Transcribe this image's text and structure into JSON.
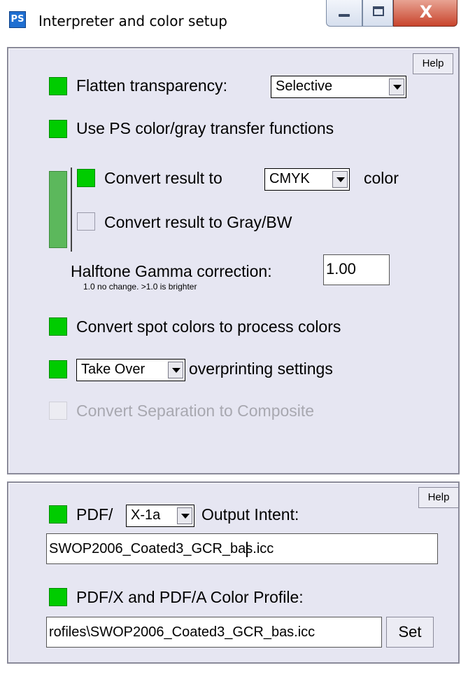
{
  "window": {
    "icon_text": "PS",
    "title": "Interpreter and color setup",
    "close_glyph": "X"
  },
  "panel1": {
    "help_label": "Help",
    "flatten": {
      "checked": true,
      "label": "Flatten transparency:",
      "value": "Selective"
    },
    "ps_transfer": {
      "checked": true,
      "label": "Use PS color/gray transfer functions"
    },
    "convert_color": {
      "checked": true,
      "label_before": "Convert result to",
      "value": "CMYK",
      "label_after": "color"
    },
    "convert_gray": {
      "checked": false,
      "label": "Convert result to Gray/BW"
    },
    "gamma": {
      "label": "Halftone Gamma correction:",
      "value": "1.00",
      "hint": "1.0 no change. >1.0 is brighter"
    },
    "spot": {
      "checked": true,
      "label": "Convert spot colors to process colors"
    },
    "overprint": {
      "checked": true,
      "value": "Take Over",
      "label": "overprinting settings"
    },
    "separation": {
      "checked": false,
      "disabled": true,
      "label": "Convert Separation to Composite"
    }
  },
  "panel2": {
    "help_label": "Help",
    "pdf_intent": {
      "checked": true,
      "label_before": "PDF/",
      "value": "X-1a",
      "label_after": "Output Intent:"
    },
    "intent_file": "SWOP2006_Coated3_GCR_bas.icc",
    "profile": {
      "checked": true,
      "label": "PDF/X and PDF/A Color Profile:"
    },
    "profile_path": "rofiles\\SWOP2006_Coated3_GCR_bas.icc",
    "set_label": "Set"
  },
  "colors": {
    "checked": "#00cc00",
    "panel_bg": "#e6e6f2",
    "group_bar": "#5cb85c"
  }
}
